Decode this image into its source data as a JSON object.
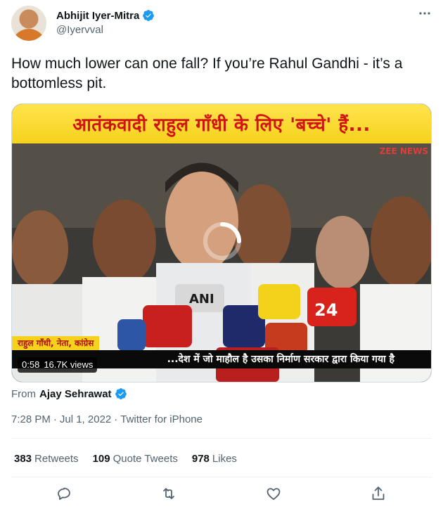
{
  "header": {
    "display_name": "Abhijit Iyer-Mitra",
    "handle": "@Iyervval"
  },
  "tweet": {
    "text": "How much lower can one fall? If you’re Rahul Gandhi - it’s a bottomless pit."
  },
  "media": {
    "banner_text": "आतंकवादी राहुल गाँधी के लिए 'बच्चे' हैं...",
    "channel_logo": "ZEE NEWS",
    "name_strap": "राहुल गाँधी, नेता, कांग्रेस",
    "ticker_text": "...देश में जो माहौल है उसका निर्माण सरकार द्वारा किया गया है",
    "duration": "0:58",
    "views": "16.7K views",
    "mic_labels": [
      "ANI",
      "24"
    ]
  },
  "source": {
    "label": "From",
    "name": "Ajay Sehrawat"
  },
  "meta": {
    "time": "7:28 PM",
    "separator": "·",
    "date": "Jul 1, 2022",
    "separator2": "·",
    "client": "Twitter for iPhone"
  },
  "stats": [
    {
      "count": "383",
      "label": "Retweets"
    },
    {
      "count": "109",
      "label": "Quote Tweets"
    },
    {
      "count": "978",
      "label": "Likes"
    }
  ],
  "icons": {
    "verified": "verified-badge-icon",
    "more": "more-icon",
    "reply": "reply-icon",
    "retweet": "retweet-icon",
    "like": "like-icon",
    "share": "share-icon"
  },
  "colors": {
    "verified_blue": "#1d9bf0",
    "text_primary": "#0f1419",
    "text_secondary": "#536471",
    "banner_yellow": "#f6d21c",
    "banner_red": "#d11313"
  }
}
